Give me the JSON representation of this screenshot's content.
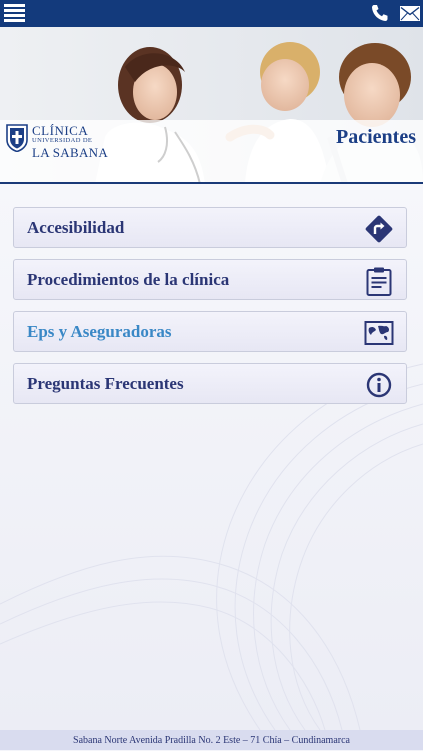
{
  "topbar": {
    "menu_icon": "hamburger-menu-icon",
    "phone_icon": "phone-icon",
    "mail_icon": "mail-icon",
    "color": "#133a7c"
  },
  "header": {
    "logo": {
      "line1": "CLÍNICA",
      "line2": "UNIVERSIDAD DE",
      "line3": "LA SABANA"
    },
    "title": "Pacientes"
  },
  "menu": {
    "items": [
      {
        "label": "Accesibilidad",
        "icon": "directions-sign-icon",
        "active": false
      },
      {
        "label": "Procedimientos de la clínica",
        "icon": "clipboard-icon",
        "active": false
      },
      {
        "label": "Eps y Aseguradoras",
        "icon": "map-icon",
        "active": true
      },
      {
        "label": "Preguntas Frecuentes",
        "icon": "info-icon",
        "active": false
      }
    ]
  },
  "footer": {
    "address": "Sabana Norte Avenida Pradilla No. 2 Este – 71 Chía – Cundinamarca"
  },
  "colors": {
    "brand": "#1c3f86",
    "label": "#2b3675",
    "active_label": "#3a88c6"
  }
}
